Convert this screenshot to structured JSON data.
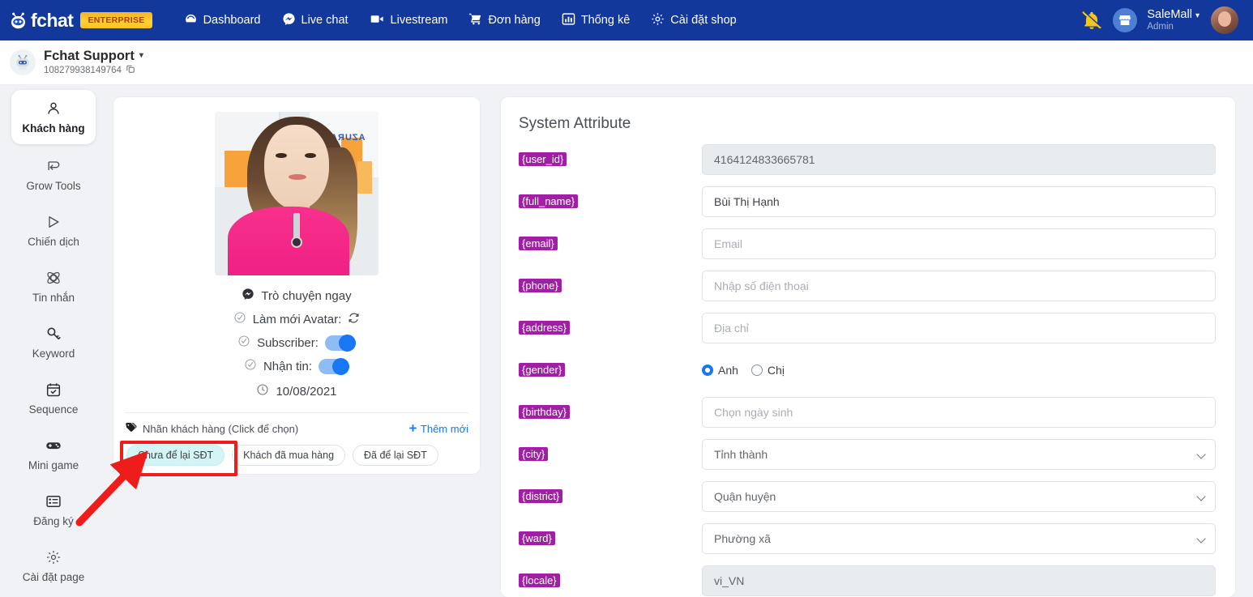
{
  "navbar": {
    "brand": "fchat",
    "brand_icon": "bot-head-icon",
    "badge": "ENTERPRISE",
    "badge_color": "#ffc21f",
    "bg_color": "#12389c",
    "items": [
      {
        "label": "Dashboard",
        "icon": "dashboard-icon"
      },
      {
        "label": "Live chat",
        "icon": "messenger-icon"
      },
      {
        "label": "Livestream",
        "icon": "video-camera-icon"
      },
      {
        "label": "Đơn hàng",
        "icon": "shopping-cart-icon"
      },
      {
        "label": "Thống kê",
        "icon": "bar-chart-icon"
      },
      {
        "label": "Cài đặt shop",
        "icon": "gear-icon"
      }
    ],
    "bell_icon": "bell-slash-icon",
    "store_icon": "store-icon",
    "account_name": "SaleMall",
    "account_role": "Admin",
    "caret": "▾"
  },
  "subheader": {
    "page_name": "Fchat Support",
    "caret": "▾",
    "page_id": "108279938149764",
    "copy_icon": "copy-icon",
    "bot_icon": "robot-avatar-icon"
  },
  "sidebar": {
    "items": [
      {
        "label": "Khách hàng",
        "icon": "user-icon",
        "active": true
      },
      {
        "label": "Grow Tools",
        "icon": "grow-tools-icon",
        "active": false
      },
      {
        "label": "Chiến dịch",
        "icon": "send-play-icon",
        "active": false
      },
      {
        "label": "Tin nhắn",
        "icon": "message-atom-icon",
        "active": false
      },
      {
        "label": "Keyword",
        "icon": "key-icon",
        "active": false
      },
      {
        "label": "Sequence",
        "icon": "calendar-check-icon",
        "active": false
      },
      {
        "label": "Mini game",
        "icon": "gamepad-icon",
        "active": false
      },
      {
        "label": "Đăng ký",
        "icon": "list-form-icon",
        "active": false
      },
      {
        "label": "Cài đặt page",
        "icon": "gear-icon",
        "active": false
      }
    ]
  },
  "profile": {
    "avatar_alt": "customer-avatar-photo",
    "chat_now": "Trò chuyện ngay",
    "chat_icon": "messenger-bubble-icon",
    "refresh_avatar_label": "Làm mới Avatar:",
    "refresh_icon": "refresh-icon",
    "subscriber_label": "Subscriber:",
    "subscriber_on": true,
    "receive_label": "Nhận tin:",
    "receive_on": true,
    "date": "10/08/2021",
    "clock_icon": "clock-icon",
    "tag_section_title": "Nhãn khách hàng (Click để chọn)",
    "tag_icon": "tag-icon",
    "add_new": "Thêm mới",
    "add_new_icon": "plus-icon",
    "tags": [
      {
        "label": "Chưa để lại SĐT",
        "selected": true,
        "highlighted": true
      },
      {
        "label": "Khách đã mua hàng",
        "selected": false,
        "highlighted": false
      },
      {
        "label": "Đã để lại SĐT",
        "selected": false,
        "highlighted": false
      }
    ]
  },
  "attributes": {
    "title": "System Attribute",
    "rows": [
      {
        "key": "{user_id}",
        "type": "text",
        "value": "4164124833665781",
        "placeholder": "",
        "readonly": true
      },
      {
        "key": "{full_name}",
        "type": "text",
        "value": "Bùi Thị Hạnh",
        "placeholder": "",
        "readonly": false
      },
      {
        "key": "{email}",
        "type": "text",
        "value": "",
        "placeholder": "Email",
        "readonly": false
      },
      {
        "key": "{phone}",
        "type": "text",
        "value": "",
        "placeholder": "Nhập số điện thoại",
        "readonly": false
      },
      {
        "key": "{address}",
        "type": "text",
        "value": "",
        "placeholder": "Địa chỉ",
        "readonly": false
      },
      {
        "key": "{gender}",
        "type": "radio",
        "options": [
          {
            "label": "Anh",
            "checked": true
          },
          {
            "label": "Chị",
            "checked": false
          }
        ]
      },
      {
        "key": "{birthday}",
        "type": "text",
        "value": "",
        "placeholder": "Chọn ngày sinh",
        "readonly": false
      },
      {
        "key": "{city}",
        "type": "select",
        "value": "Tỉnh thành"
      },
      {
        "key": "{district}",
        "type": "select",
        "value": "Quận huyện"
      },
      {
        "key": "{ward}",
        "type": "select",
        "value": "Phường xã"
      },
      {
        "key": "{locale}",
        "type": "text",
        "value": "vi_VN",
        "placeholder": "",
        "readonly": true
      }
    ],
    "badge_color": "#a01fa5"
  },
  "annotation": {
    "arrow_color": "#ef1c1c",
    "highlight_color": "#ef1c1c"
  }
}
